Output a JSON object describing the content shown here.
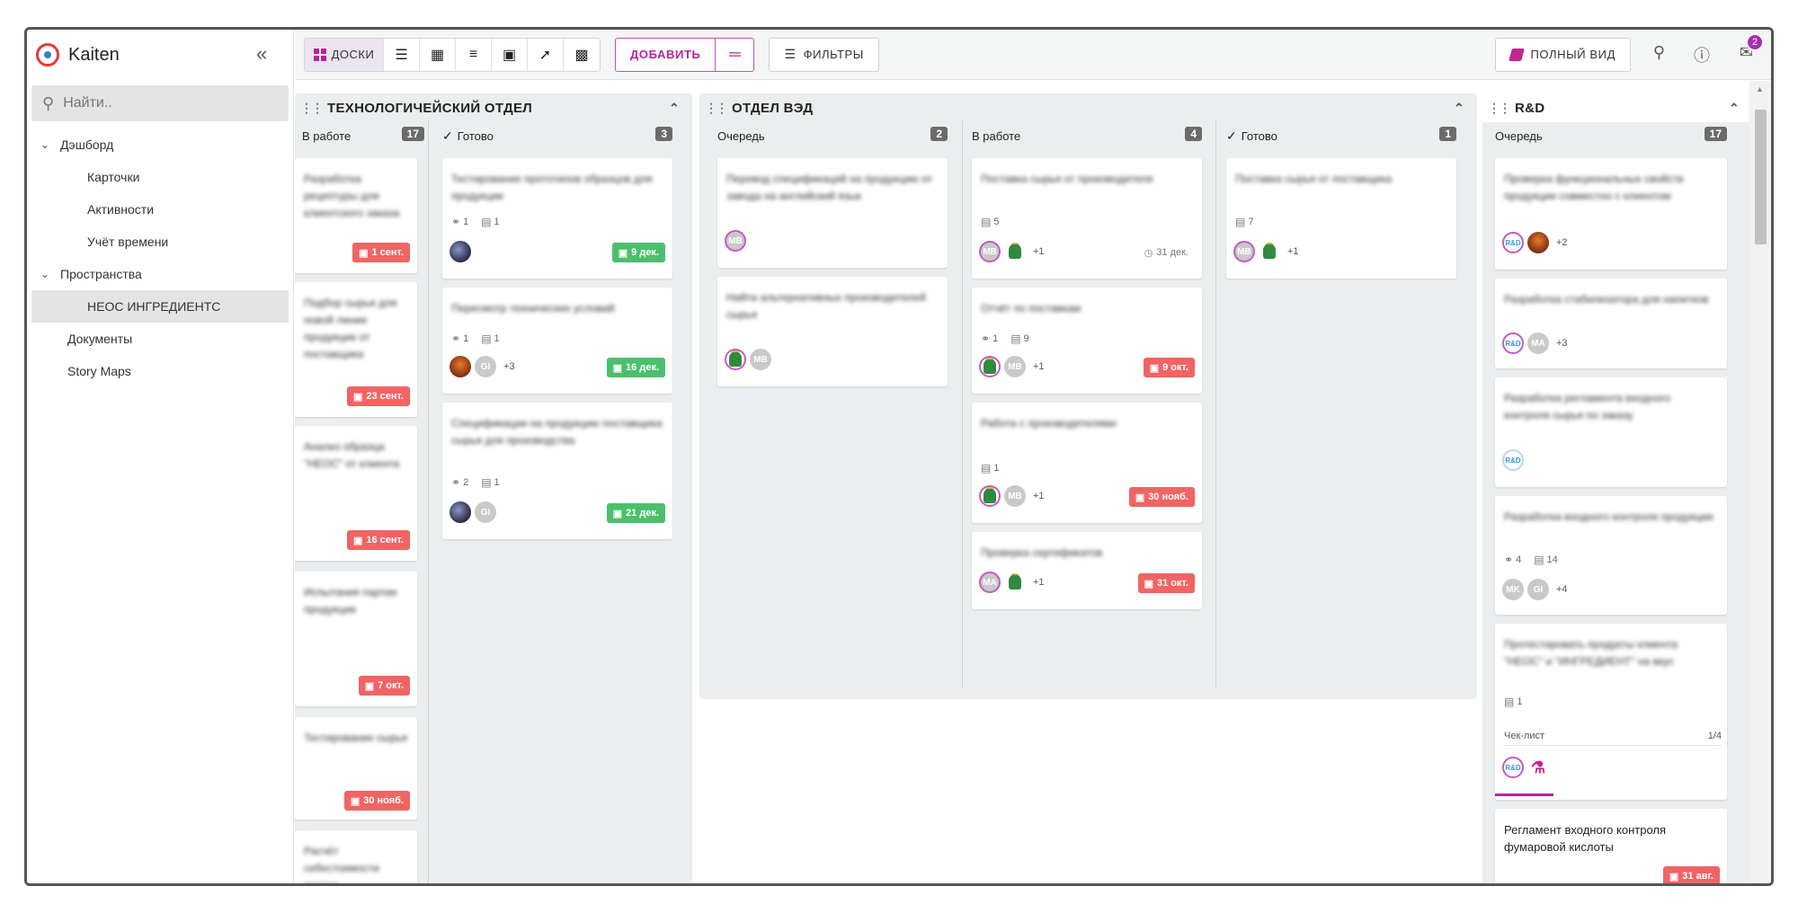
{
  "app": {
    "name": "Kaiten"
  },
  "sidebar": {
    "search_placeholder": "Найти..",
    "items": [
      {
        "label": "Дэшборд",
        "level": 0,
        "chevron": true
      },
      {
        "label": "Карточки",
        "level": 1
      },
      {
        "label": "Активности",
        "level": 1
      },
      {
        "label": "Учёт времени",
        "level": 1
      },
      {
        "label": "Пространства",
        "level": 0,
        "chevron": true
      },
      {
        "label": "НЕОС ИНГРЕДИЕНТС",
        "level": 1,
        "active": true
      },
      {
        "label": "Документы",
        "level": 0
      },
      {
        "label": "Story Maps",
        "level": 0
      }
    ]
  },
  "toolbar": {
    "boards_label": "ДОСКИ",
    "add_label": "ДОБАВИТЬ",
    "filters_label": "ФИЛЬТРЫ",
    "full_view_label": "ПОЛНЫЙ ВИД",
    "mail_badge": "2"
  },
  "colors": {
    "accent": "#b4259b",
    "due_red": "#f06464",
    "due_green": "#4cbf6d",
    "space_bg": "#ebeeef"
  },
  "spaces": {
    "tech": {
      "title": "ТЕХНОЛОГИЧЕЙСКИЙ ОТДЕЛ",
      "col_in_work": {
        "label": "В работе",
        "count": "17"
      },
      "col_done": {
        "label": "Готово",
        "count": "3"
      },
      "in_work_cards": [
        {
          "title": "Разработка рецептуры для клиентского заказа",
          "due": "1 сент."
        },
        {
          "title": "Подбор сырья для новой линии продукции от поставщика",
          "due": "23 сент."
        },
        {
          "title": "Анализ образца \"НЕОС\" от клиента",
          "due": "16 сент."
        },
        {
          "title": "Испытания партии продукции",
          "due": "7 окт."
        },
        {
          "title": "Тестирование сырья",
          "due": "30 нояб."
        },
        {
          "title": "Расчёт себестоимости партии",
          "due": ""
        }
      ],
      "done_cards": [
        {
          "title": "Тестирование прототипов образцов для продукции",
          "attach": "1",
          "comments": "1",
          "due": "9 дек."
        },
        {
          "title": "Пересмотр технических условий",
          "attach": "1",
          "comments": "1",
          "more": "+3",
          "due": "16 дек."
        },
        {
          "title": "Спецификации на продукцию поставщика сырья для производства",
          "attach": "2",
          "comments": "1",
          "due": "21 дек."
        }
      ]
    },
    "ved": {
      "title": "ОТДЕЛ ВЭД",
      "col_queue": {
        "label": "Очередь",
        "count": "2"
      },
      "col_in_work": {
        "label": "В работе",
        "count": "4"
      },
      "col_done": {
        "label": "Готово",
        "count": "1"
      },
      "queue_cards": [
        {
          "title": "Перевод спецификаций на продукцию от завода на английский язык"
        },
        {
          "title": "Найти альтернативных производителей сырья"
        }
      ],
      "in_work_cards": [
        {
          "title": "Поставка сырья от производителя",
          "comments": "5",
          "more": "+1",
          "due": "31 дек."
        },
        {
          "title": "Отчёт по поставкам",
          "attach": "1",
          "comments": "9",
          "more": "+1",
          "due": "9 окт."
        },
        {
          "title": "Работа с производителями",
          "comments": "1",
          "more": "+1",
          "due": "30 нояб."
        },
        {
          "title": "Проверка сертификатов",
          "more": "+1",
          "due": "31 окт."
        }
      ],
      "done_cards": [
        {
          "title": "Поставка сырья от поставщика",
          "comments": "7",
          "more": "+1"
        }
      ]
    },
    "rd": {
      "title": "R&D",
      "col_queue": {
        "label": "Очередь",
        "count": "17"
      },
      "queue_cards": [
        {
          "title": "Проверка функциональных свойств продукции совместно с клиентом",
          "more": "+2"
        },
        {
          "title": "Разработка стабилизатора для напитков",
          "more": "+3"
        },
        {
          "title": "Разработка регламента входного контроля сырья по заказу"
        },
        {
          "title": "Разработка входного контроля продукции",
          "attach": "4",
          "comments": "14",
          "more": "+4"
        },
        {
          "title": "Протестировать продукты клиента \"НЕОС\" и \"ИНГРЕДИЕНТ\" на вкус",
          "comments": "1",
          "checklist_label": "Чек-лист",
          "checklist_progress": "1/4",
          "checklist_fraction": 0.25
        },
        {
          "title": "Регламент входного контроля фумаровой кислоты",
          "due": "31 авг."
        }
      ]
    }
  }
}
